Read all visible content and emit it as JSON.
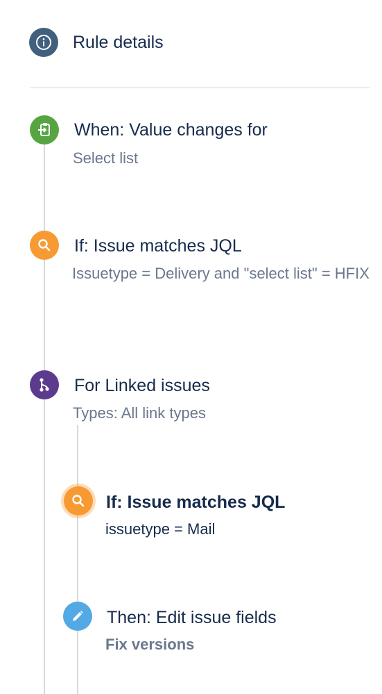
{
  "rule_details": {
    "label": "Rule details",
    "color": "#42607e",
    "icon": "info-icon"
  },
  "trigger": {
    "title": "When: Value changes for",
    "detail": "Select list",
    "color": "#57a542",
    "icon": "field-change-icon"
  },
  "condition": {
    "title": "If: Issue matches JQL",
    "detail": "Issuetype = Delivery and \"select list\" = HFIX",
    "color": "#f89a33",
    "icon": "search-icon"
  },
  "branch": {
    "title": "For Linked issues",
    "detail": "Types: All link types",
    "color": "#5c3b8f",
    "icon": "branch-icon"
  },
  "branch_condition": {
    "title": "If: Issue matches JQL",
    "detail": "issuetype = Mail",
    "color": "#f89a33",
    "icon": "search-icon"
  },
  "branch_action": {
    "title": "Then: Edit issue fields",
    "detail": "Fix versions",
    "color": "#53a9e3",
    "icon": "pencil-icon"
  }
}
